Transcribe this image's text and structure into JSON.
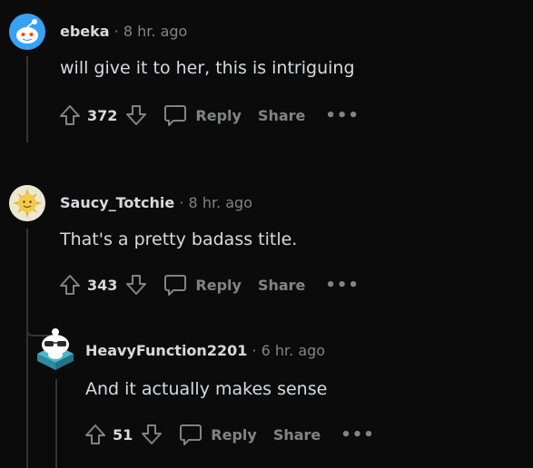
{
  "comments": [
    {
      "user": "ebeka",
      "time": "8 hr. ago",
      "text": "will give it to her, this is intriguing",
      "score": "372",
      "reply_label": "Reply",
      "share_label": "Share",
      "more_label": "•••",
      "avatar_icon": "snoo-avatar-blue"
    },
    {
      "user": "Saucy_Totchie",
      "time": "8 hr. ago",
      "text": "That's a pretty badass title.",
      "score": "343",
      "reply_label": "Reply",
      "share_label": "Share",
      "more_label": "•••",
      "avatar_icon": "sun-avatar"
    },
    {
      "user": "HeavyFunction2201",
      "time": "6 hr. ago",
      "text": "And it actually makes sense",
      "score": "51",
      "reply_label": "Reply",
      "share_label": "Share",
      "more_label": "•••",
      "avatar_icon": "snoo-avatar-sunglasses"
    }
  ],
  "separator": "·",
  "colors": {
    "background": "#0b0b0c",
    "text": "#d7dadc",
    "muted": "#818384",
    "thread_line": "#343536",
    "snoo_blue": "#3aa0f0"
  }
}
